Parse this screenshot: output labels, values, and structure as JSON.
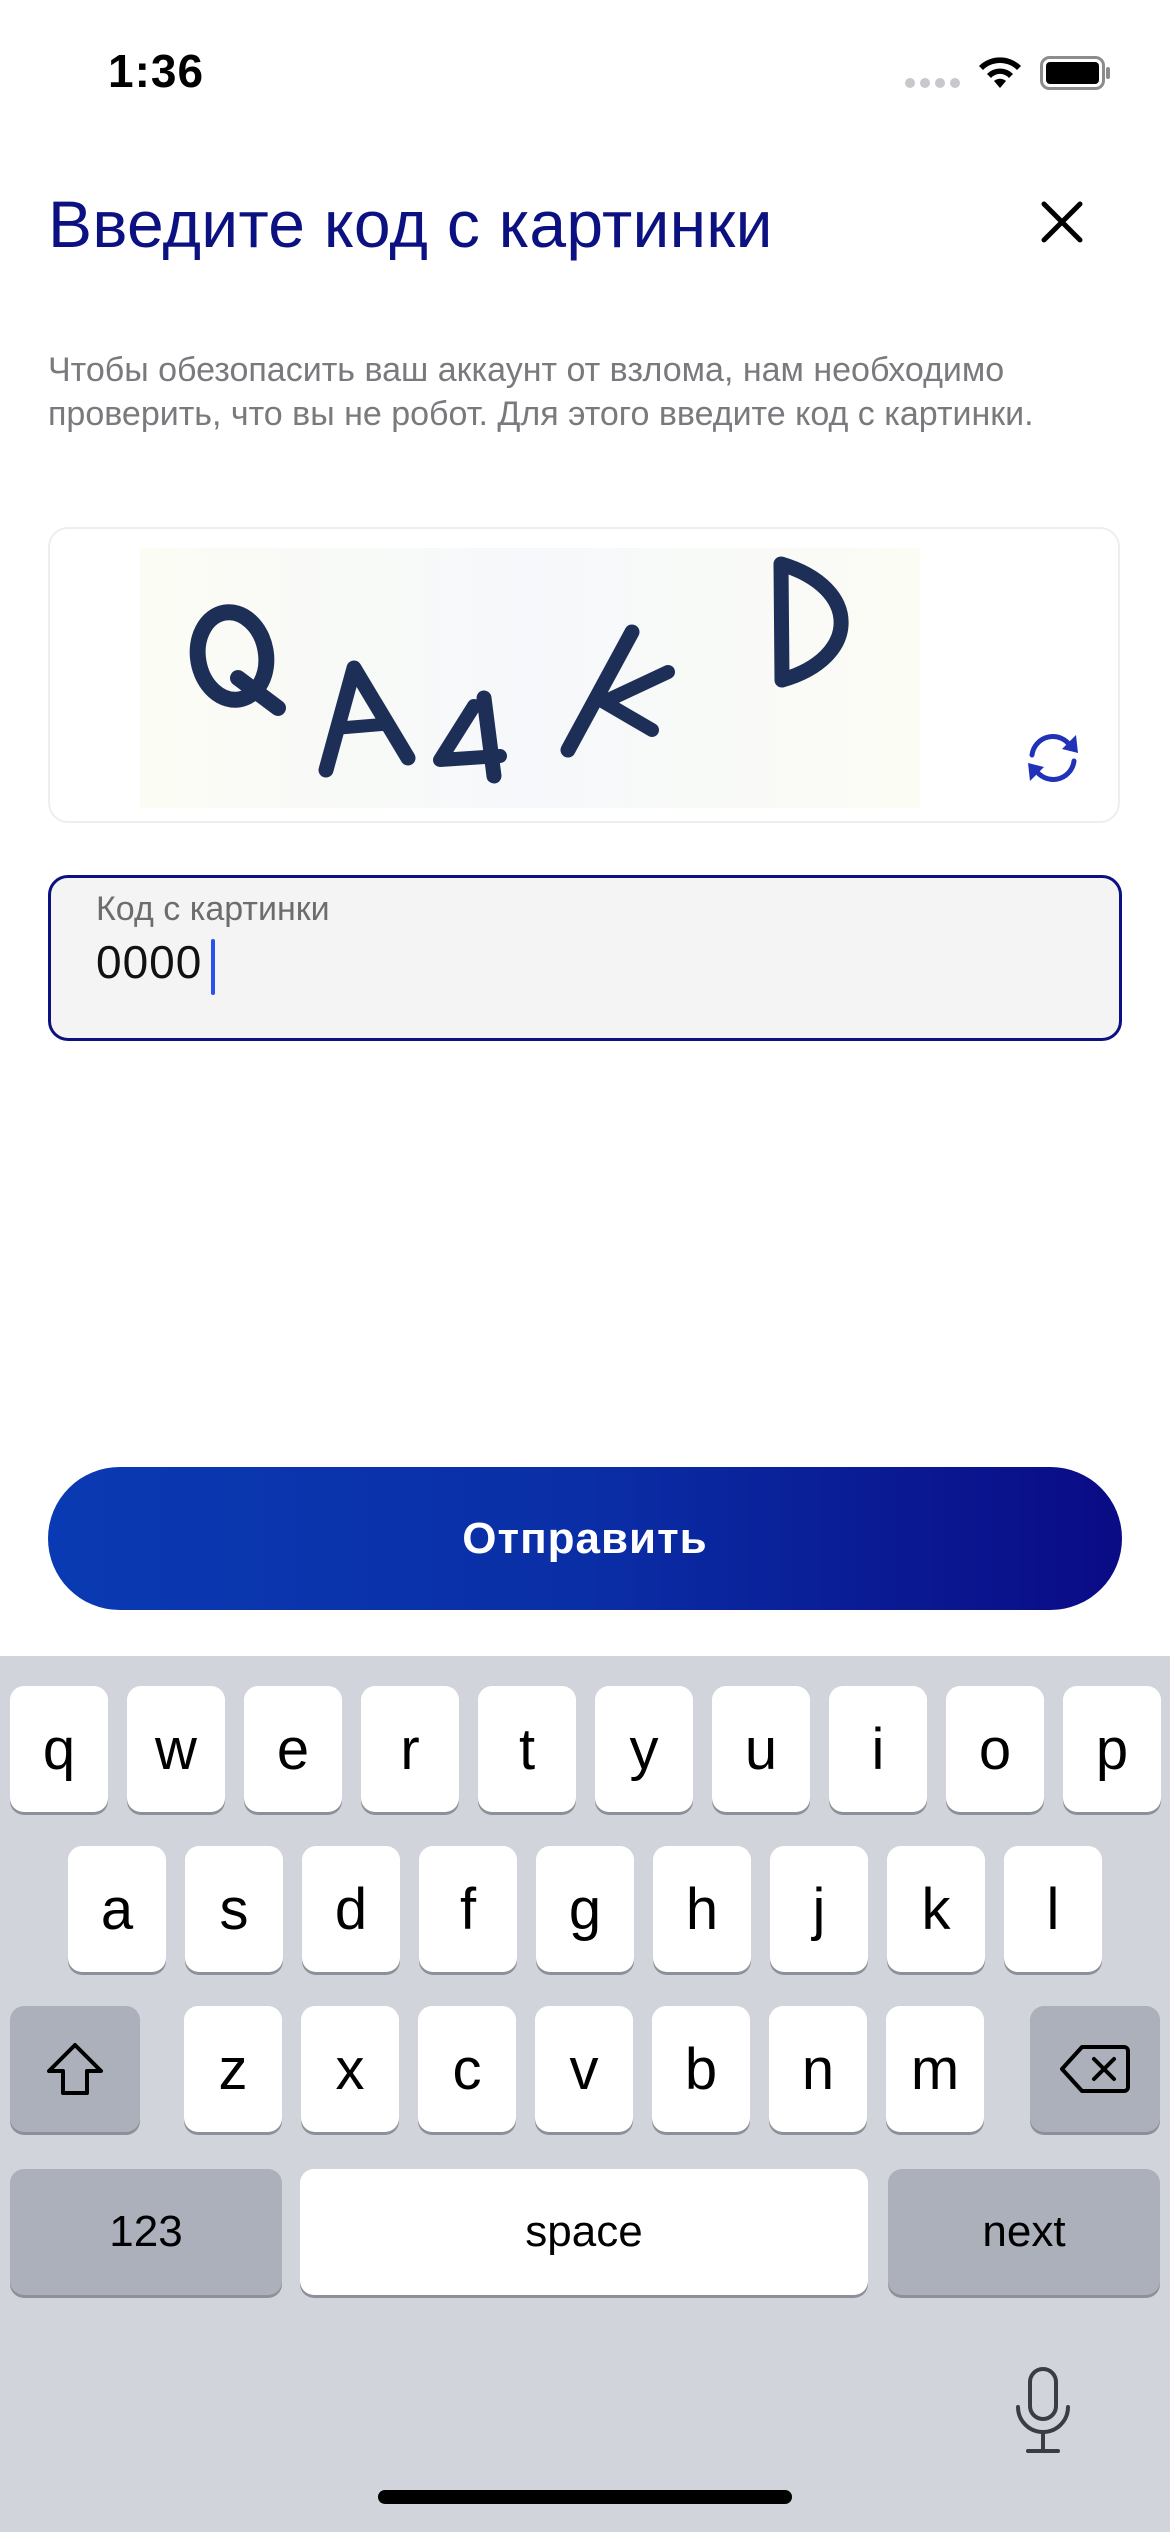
{
  "status_bar": {
    "time": "1:36"
  },
  "header": {
    "title": "Введите код с картинки"
  },
  "description": "Чтобы обезопасить ваш аккаунт от взлома, нам необходимо проверить, что вы не робот. Для этого введите код с картинки.",
  "captcha": {
    "text": "QA4KD"
  },
  "code_input": {
    "label": "Код с картинки",
    "value": "0000"
  },
  "submit_button": {
    "label": "Отправить"
  },
  "colors": {
    "brand": "#0b1180",
    "button_gradient_start": "#0a3ab3",
    "button_gradient_end": "#0a0b85",
    "cursor": "#2b52e8"
  },
  "keyboard": {
    "row1": [
      "q",
      "w",
      "e",
      "r",
      "t",
      "y",
      "u",
      "i",
      "o",
      "p"
    ],
    "row2": [
      "a",
      "s",
      "d",
      "f",
      "g",
      "h",
      "j",
      "k",
      "l"
    ],
    "row3": [
      "z",
      "x",
      "c",
      "v",
      "b",
      "n",
      "m"
    ],
    "numbers_label": "123",
    "space_label": "space",
    "return_label": "next",
    "icons": [
      "shift-icon",
      "delete-icon",
      "microphone-icon"
    ]
  }
}
